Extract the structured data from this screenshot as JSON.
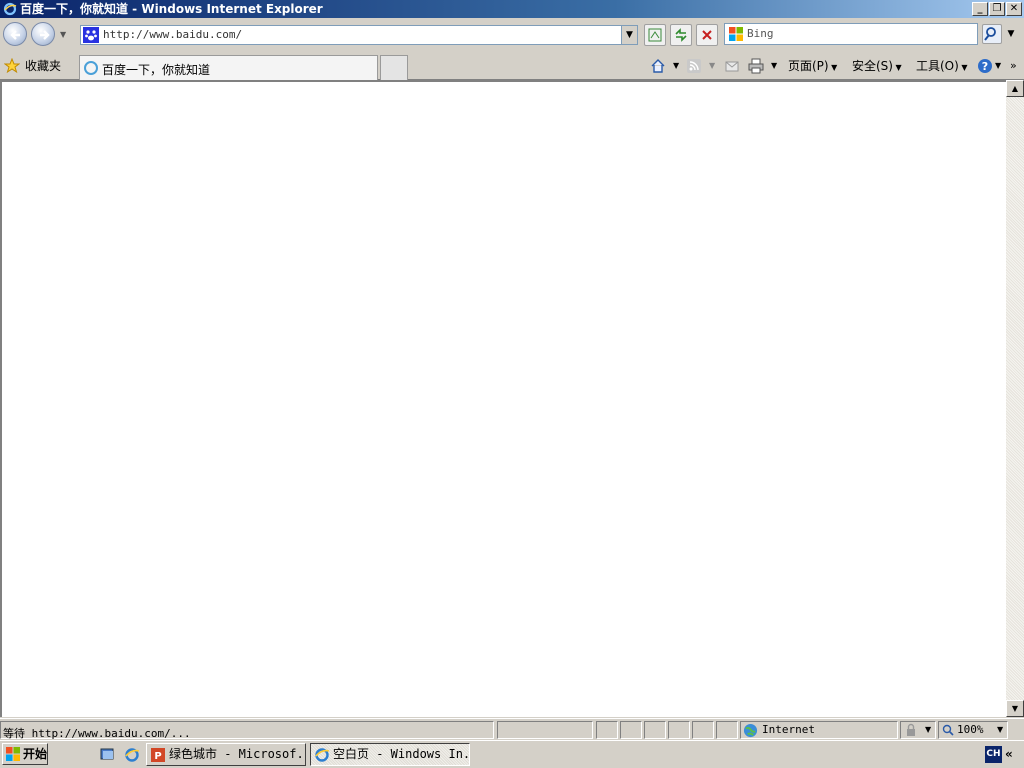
{
  "window": {
    "title": "百度一下，你就知道 - Windows Internet Explorer"
  },
  "navbar": {
    "url": "http://www.baidu.com/",
    "search_placeholder": "Bing"
  },
  "tabs": [
    {
      "label": "百度一下，你就知道",
      "active": true
    }
  ],
  "favorites_label": "收藏夹",
  "commandbar": {
    "page_label": "页面(P)",
    "safety_label": "安全(S)",
    "tools_label": "工具(O)",
    "help_icon": "help-icon"
  },
  "statusbar": {
    "text": "等待 http://www.baidu.com/...",
    "zone": "Internet",
    "zoom": "100%"
  },
  "taskbar": {
    "start_label": "开始",
    "buttons": [
      {
        "label": "绿色城市 - Microsof...",
        "active": false
      },
      {
        "label": "空白页 - Windows In...",
        "active": true
      }
    ],
    "language": "CH"
  },
  "colors": {
    "titlebar_start": "#0a246a",
    "titlebar_end": "#a6caf0",
    "chrome": "#d4d0c8"
  }
}
